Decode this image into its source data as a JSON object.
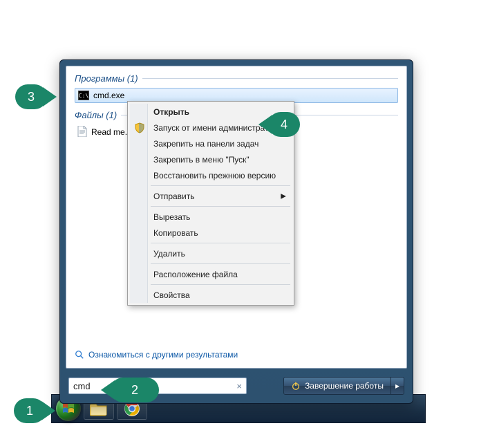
{
  "taskbar": {
    "items": [
      "start",
      "file-explorer",
      "chrome"
    ]
  },
  "start": {
    "groups": {
      "programs": {
        "label": "Программы (1)",
        "items": [
          {
            "name": "cmd.exe"
          }
        ]
      },
      "files": {
        "label": "Файлы (1)",
        "items": [
          {
            "name": "Read me.txt"
          }
        ]
      }
    },
    "see_more": "Ознакомиться с другими результатами",
    "search": {
      "value": "cmd",
      "clear_glyph": "×"
    },
    "shutdown": {
      "label": "Завершение работы",
      "arrow": "▸"
    }
  },
  "context_menu": {
    "items": [
      {
        "label": "Открыть",
        "bold": true
      },
      {
        "label": "Запуск от имени администратора",
        "icon": "shield"
      },
      {
        "label": "Закрепить на панели задач"
      },
      {
        "label": "Закрепить в меню \"Пуск\""
      },
      {
        "label": "Восстановить прежнюю версию"
      },
      {
        "sep": true
      },
      {
        "label": "Отправить",
        "submenu": true
      },
      {
        "sep": true
      },
      {
        "label": "Вырезать"
      },
      {
        "label": "Копировать"
      },
      {
        "sep": true
      },
      {
        "label": "Удалить"
      },
      {
        "sep": true
      },
      {
        "label": "Расположение файла"
      },
      {
        "sep": true
      },
      {
        "label": "Свойства"
      }
    ]
  },
  "badges": {
    "1": "1",
    "2": "2",
    "3": "3",
    "4": "4"
  }
}
